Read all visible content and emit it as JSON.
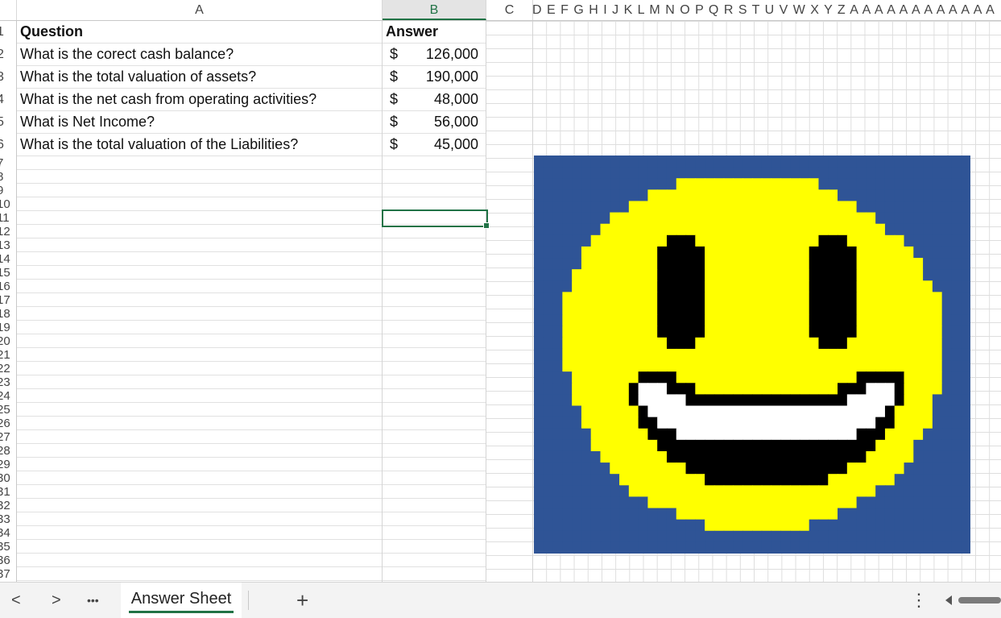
{
  "columns": {
    "a": "A",
    "b": "B",
    "c": "C",
    "narrow": "D E F G H I J K L M N O P Q R S T U V W X Y Z A A A A A A A A A A A A"
  },
  "row_numbers": [
    "1",
    "2",
    "3",
    "4",
    "5",
    "6",
    "7",
    "8",
    "9",
    "10",
    "11",
    "12",
    "13",
    "14",
    "15",
    "16",
    "17",
    "18",
    "19",
    "20",
    "21",
    "22",
    "23",
    "24",
    "25",
    "26",
    "27",
    "28",
    "29",
    "30",
    "31",
    "32",
    "33",
    "34",
    "35",
    "36",
    "37"
  ],
  "table": {
    "header": {
      "question": "Question",
      "answer": "Answer"
    },
    "rows": [
      {
        "question": "What is the corect cash balance?",
        "currency": "$",
        "amount": "126,000"
      },
      {
        "question": "What is the total valuation of assets?",
        "currency": "$",
        "amount": "190,000"
      },
      {
        "question": "What is the net cash from operating activities?",
        "currency": "$",
        "amount": "48,000"
      },
      {
        "question": "What is Net Income?",
        "currency": "$",
        "amount": "56,000"
      },
      {
        "question": "What is the total valuation of the Liabilities?",
        "currency": "$",
        "amount": "45,000"
      }
    ]
  },
  "pixel_art": {
    "colors": {
      "background": "#2f5496",
      "yellow": "#ffff00",
      "black": "#000000",
      "white": "#ffffff"
    },
    "grid": [
      "BBBBBBBBBBBBBBBBBBBBBBBBBBBBBBBBBBBBBBBBBBBBBB",
      "BBBBBBBBBBBBBBBBBBBBBBBBBBBBBBBBBBBBBBBBBBBBBB",
      "BBBBBBBBBBBBBBBYYYYYYYYYYYYYYYBBBBBBBBBBBBBBBB",
      "BBBBBBBBBBBBYYYYYYYYYYYYYYYYYYYYBBBBBBBBBBBBBB",
      "BBBBBBBBBBYYYYYYYYYYYYYYYYYYYYYYYYBBBBBBBBBBBB",
      "BBBBBBBBYYYYYYYYYYYYYYYYYYYYYYYYYYYYBBBBBBBBBB",
      "BBBBBBBYYYYYYYYYYYYYYYYYYYYYYYYYYYYYYBBBBBBBBB",
      "BBBBBBYYYYYYYYKKKYYYYYYYYYYYYYKKKYYYYYYBBBBBBB",
      "BBBBBYYYYYYYYKKKKKYYYYYYYYYYYKKKKKYYYYYYBBBBBB",
      "BBBBBYYYYYYYYKKKKKYYYYYYYYYYYKKKKKYYYYYYYBBBBB",
      "BBBBYYYYYYYYYKKKKKYYYYYYYYYYYKKKKKYYYYYYYBBBBB",
      "BBBBYYYYYYYYYKKKKKYYYYYYYYYYYKKKKKYYYYYYYYBBBB",
      "BBBYYYYYYYYYYKKKKKYYYYYYYYYYYKKKKKYYYYYYYYYBBB",
      "BBBYYYYYYYYYYKKKKKYYYYYYYYYYYKKKKKYYYYYYYYYBBB",
      "BBBYYYYYYYYYYKKKKKYYYYYYYYYYYKKKKKYYYYYYYYYBBB",
      "BBBYYYYYYYYYYKKKKKYYYYYYYYYYYKKKKKYYYYYYYYYBBB",
      "BBBYYYYYYYYYYYKKKYYYYYYYYYYYYYKKKYYYYYYYYYYBBB",
      "BBBYYYYYYYYYYYYYYYYYYYYYYYYYYYYYYYYYYYYYYYYBBB",
      "BBBYYYYYYYYYYYYYYYYYYYYYYYYYYYYYYYYYYYYYYYYBBB",
      "BBBBYYYYYYYKKKKYYYYYYYYYYYYYYYYYYYKKKKKYYYYBBB",
      "BBBBYYYYYYKWWWKKKYYYYYYYYYYYYYYYKKKWWWKYYYYBBB",
      "BBBBYYYYYYKWWWWWKKKKKKKKKKKKKKKKKWWWWWKYYYBBBB",
      "BBBBBYYYYYYKWWWWWWWWWWWWWWWWWWWWWWWWWKYYYYBBBB",
      "BBBBBYYYYYYKKWWWWWWWWWWWWWWWWWWWWWWWKKYYYYBBBB",
      "BBBBBBYYYYYYKKKWWWWWWWWWWWWWWWWWWWKKKYYYYBBBBB",
      "BBBBBBYYYYYYYKKKKKKKKKKKKKKKKKKKKKKKYYYYBBBBBB",
      "BBBBBBBYYYYYYYKKKKKKKKKKKKKKKKKKKKKYYYYYBBBBBB",
      "BBBBBBBBYYYYYYYYKKKKKKKKKKKKKKKKKYYYYYYBBBBBBB",
      "BBBBBBBBBYYYYYYYYYKKKKKKKKKKKKKYYYYYYYBBBBBBBB",
      "BBBBBBBBBBYYYYYYYYYYYYYYYYYYYYYYYYYYBBBBBBBBBB",
      "BBBBBBBBBBBBYYYYYYYYYYYYYYYYYYYYYYBBBBBBBBBBBB",
      "BBBBBBBBBBBBBBBYYYYYYYYYYYYYYYYYBBBBBBBBBBBBBB",
      "BBBBBBBBBBBBBBBBBBYYYYYYYYYYYBBBBBBBBBBBBBBBBB",
      "BBBBBBBBBBBBBBBBBBBBBBBBBBBBBBBBBBBBBBBBBBBBBB",
      "BBBBBBBBBBBBBBBBBBBBBBBBBBBBBBBBBBBBBBBBBBBBBB"
    ]
  },
  "tabs": {
    "prev": "<",
    "next": ">",
    "more": "•••",
    "active": "Answer Sheet",
    "add": "+",
    "options": "⋮"
  }
}
